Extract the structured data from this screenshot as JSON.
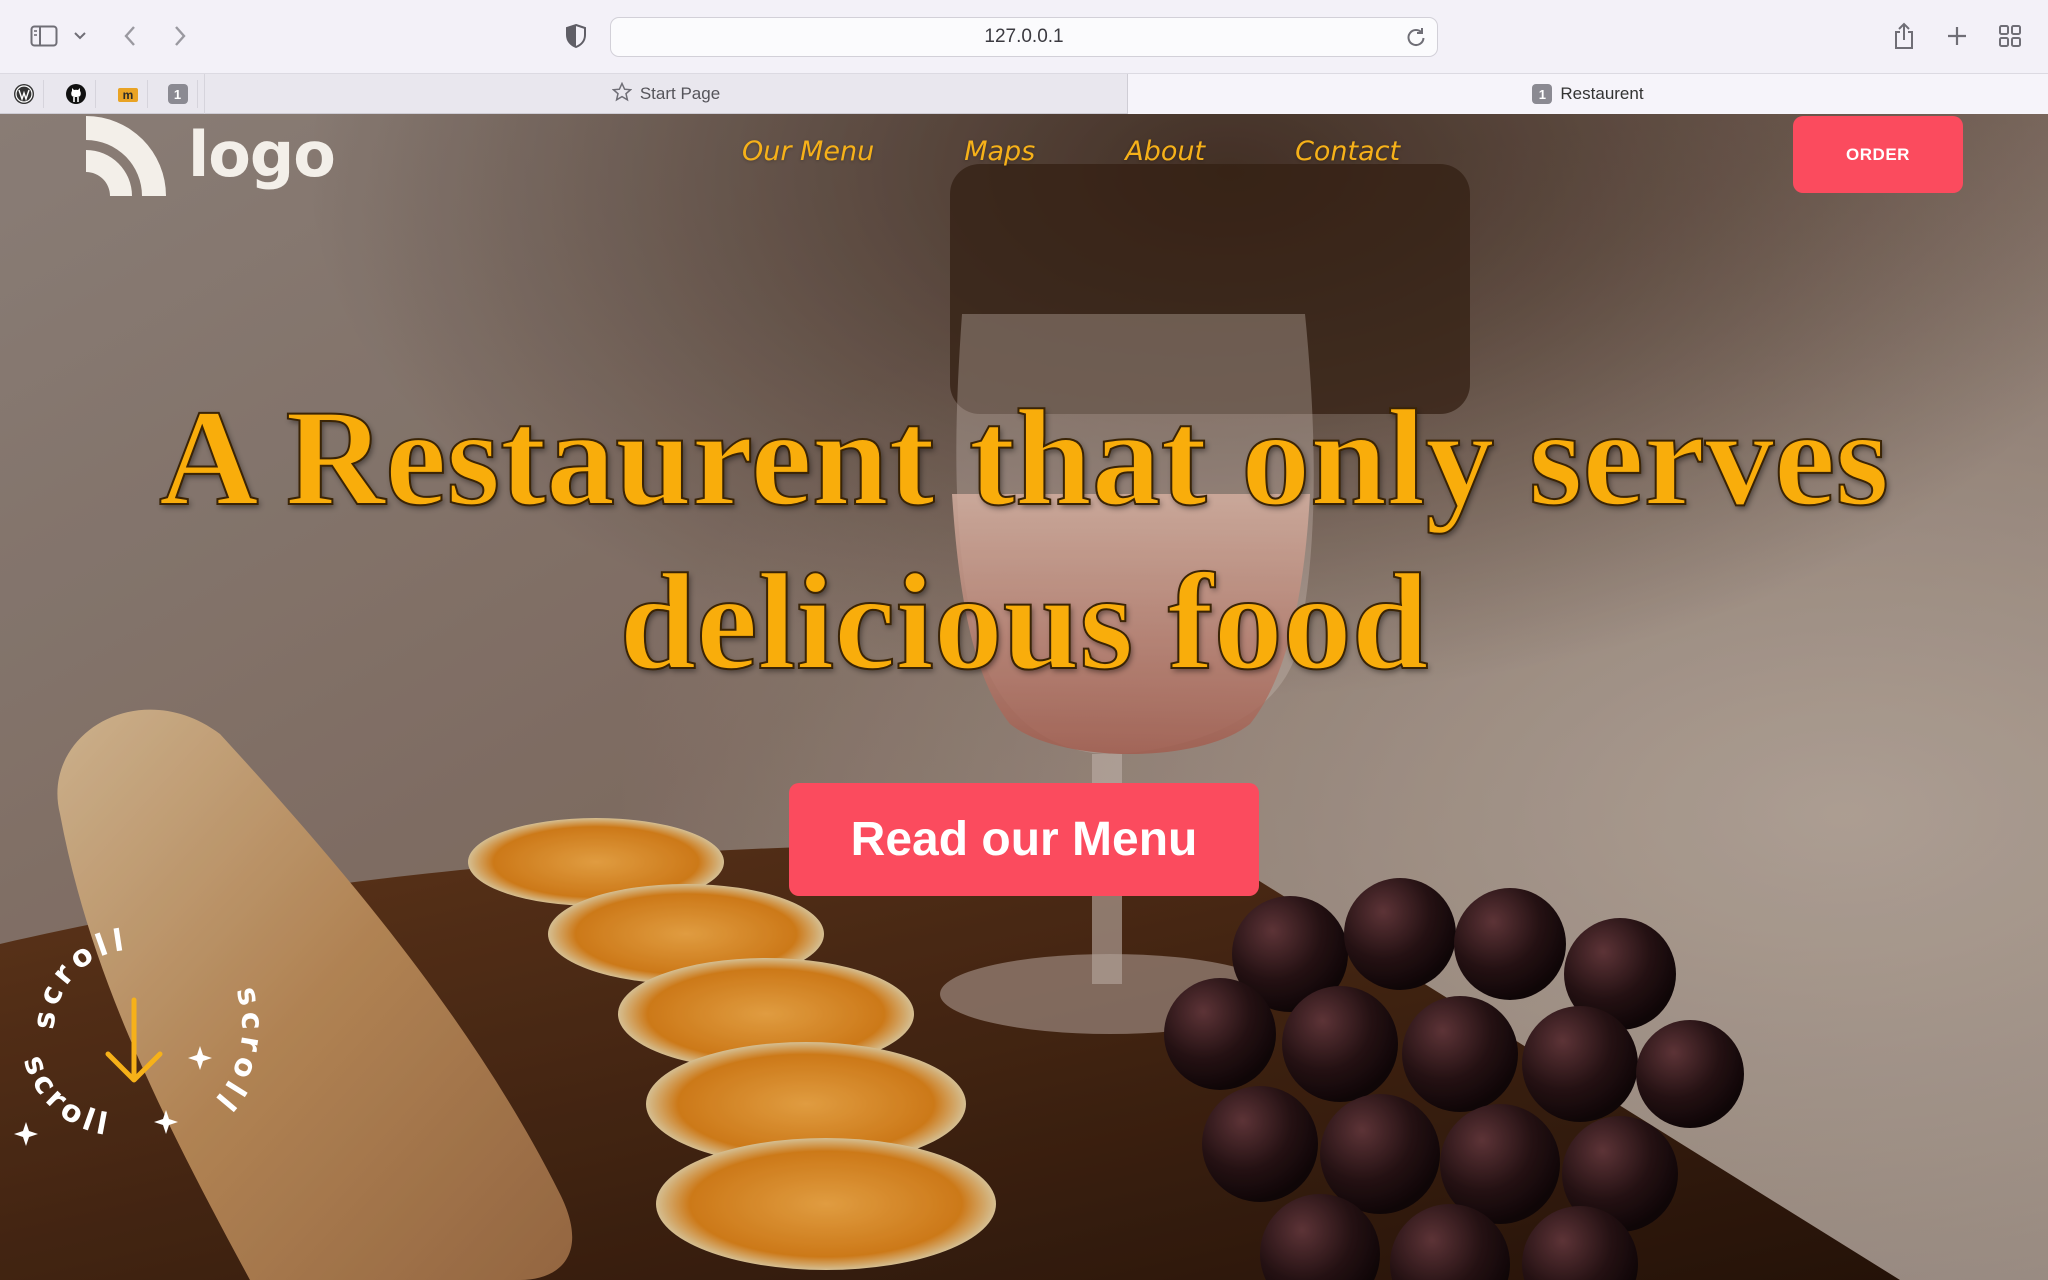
{
  "browser": {
    "url": "127.0.0.1",
    "tabs": [
      {
        "label": "Start Page"
      },
      {
        "label": "Restaurent",
        "badge": "1"
      }
    ],
    "favorites_badge": "1"
  },
  "site": {
    "logo_text": "logo",
    "nav": [
      "Our Menu",
      "Maps",
      "About",
      "Contact"
    ],
    "order_label": "ORDER",
    "hero_line1": "A Restaurent that only serves",
    "hero_line2": "delicious food",
    "cta_label": "Read our Menu",
    "scroll_text": "scroll"
  },
  "colors": {
    "accent": "#fb4b5e",
    "title": "#f9ad0b",
    "nav": "#f6b119"
  }
}
